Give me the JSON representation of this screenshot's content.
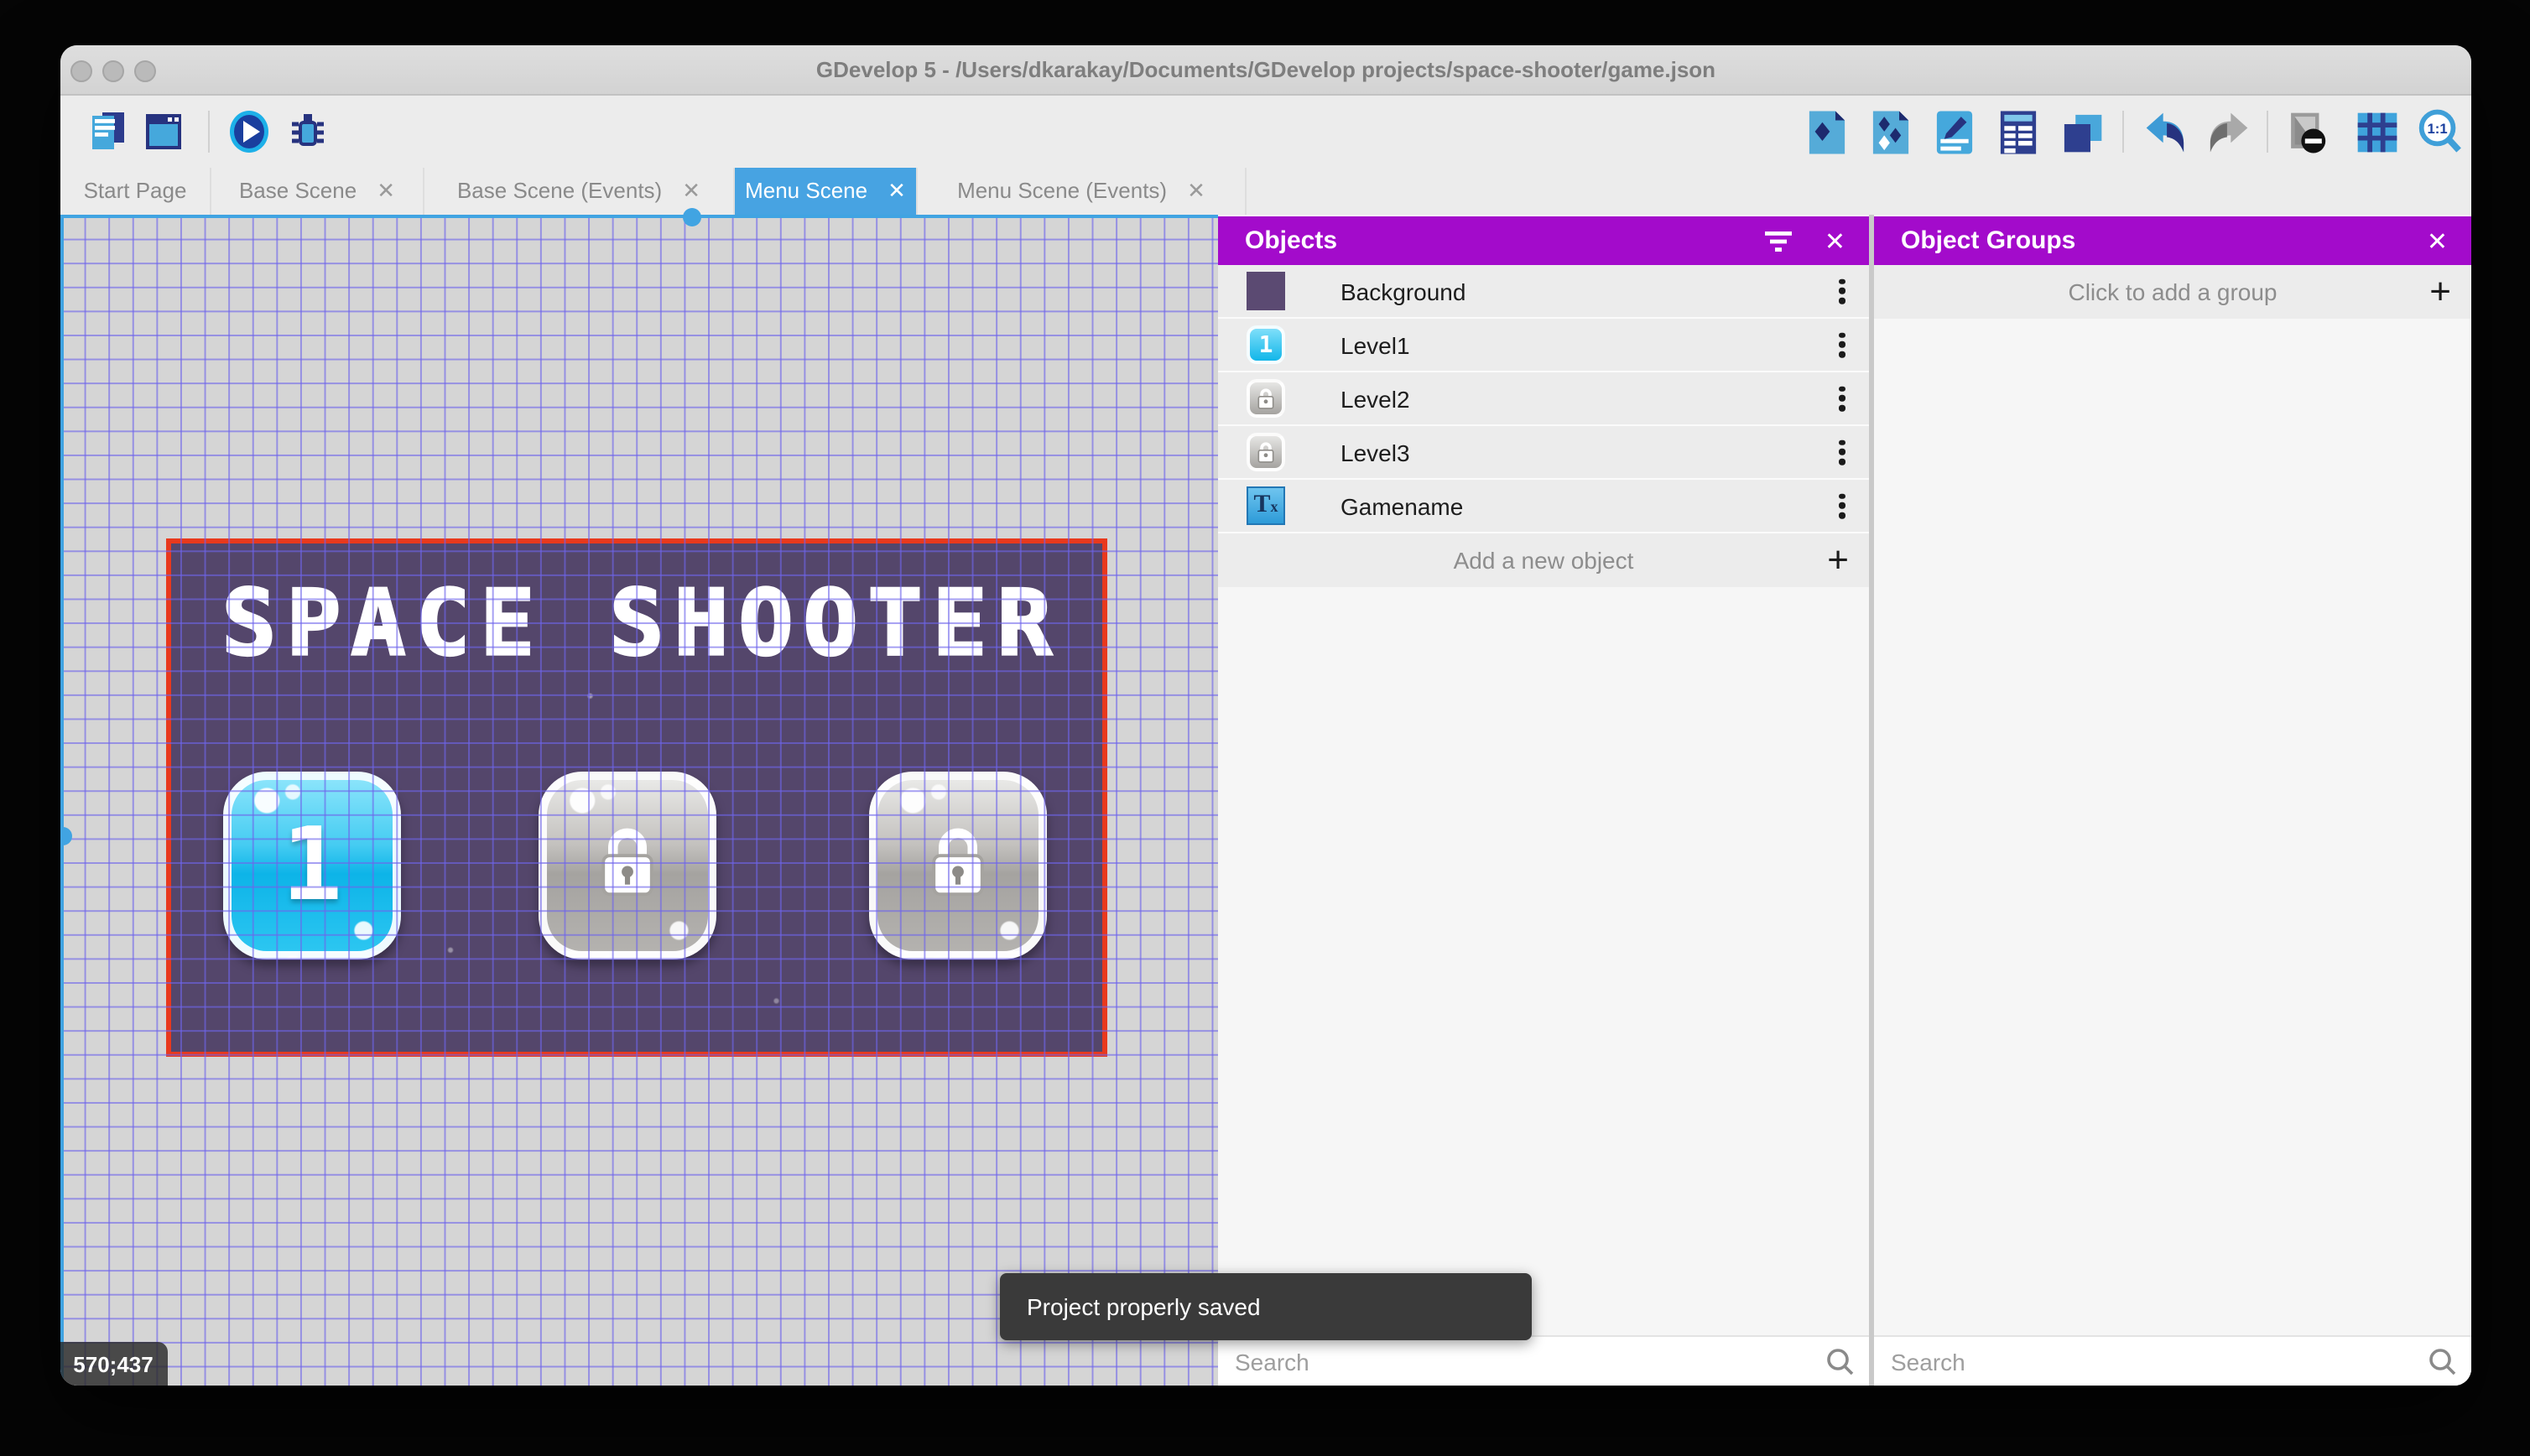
{
  "window": {
    "title": "GDevelop 5 - /Users/dkarakay/Documents/GDevelop projects/space-shooter/game.json"
  },
  "tabs": [
    {
      "label": "Start Page",
      "closable": false
    },
    {
      "label": "Base Scene",
      "closable": true
    },
    {
      "label": "Base Scene (Events)",
      "closable": true
    },
    {
      "label": "Menu Scene",
      "closable": true,
      "active": true
    },
    {
      "label": "Menu Scene (Events)",
      "closable": true
    }
  ],
  "tab_close_glyph": "✕",
  "toolbar": {
    "left_icons": [
      "project-manager",
      "preview-window",
      "play",
      "debug"
    ],
    "right_icons": [
      "export",
      "publish",
      "edit-scene",
      "properties-list",
      "layers",
      "undo",
      "redo",
      "mask-render",
      "grid",
      "zoom-1-1"
    ]
  },
  "scene": {
    "title": "SPACE SHOOTER",
    "level1_label": "1"
  },
  "objects_panel": {
    "title": "Objects",
    "items": [
      {
        "label": "Background",
        "icon": "background-sprite"
      },
      {
        "label": "Level1",
        "icon": "level1-button"
      },
      {
        "label": "Level2",
        "icon": "locked-button"
      },
      {
        "label": "Level3",
        "icon": "locked-button"
      },
      {
        "label": "Gamename",
        "icon": "text-object"
      }
    ],
    "add_label": "Add a new object",
    "search_placeholder": "Search"
  },
  "groups_panel": {
    "title": "Object Groups",
    "empty_label": "Click to add a group",
    "search_placeholder": "Search"
  },
  "toast": {
    "message": "Project properly saved"
  },
  "glyphs": {
    "close": "✕",
    "plus": "+",
    "text_icon_t": "T",
    "text_icon_x": "x"
  },
  "statusbar": {
    "coordinates": "570;437"
  },
  "colors": {
    "panel_header_purple": "#a30bcb",
    "active_tab_blue": "#47a3e2",
    "scene_background": "#54466b",
    "scene_border_red": "#e8391d",
    "level_button_blue": "#0db4e8",
    "grid_line": "#655be2"
  }
}
